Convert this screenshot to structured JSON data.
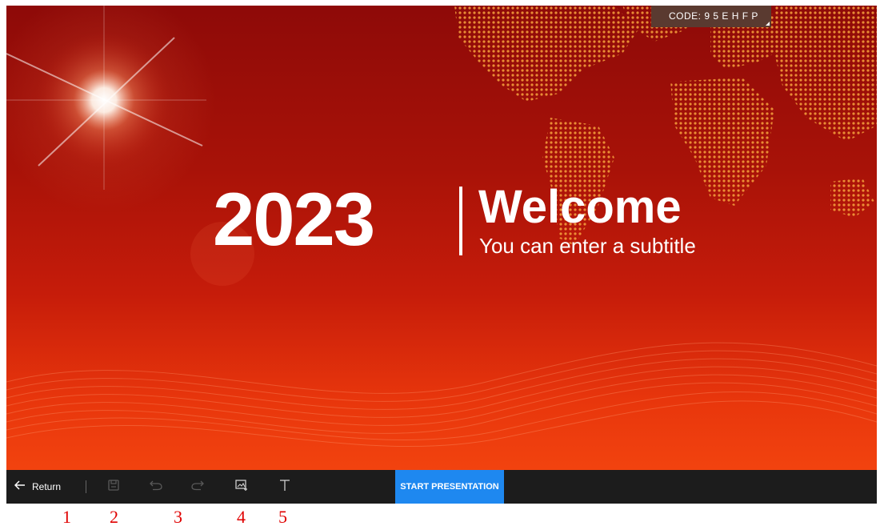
{
  "slide": {
    "year": "2023",
    "title": "Welcome",
    "subtitle": "You can enter a subtitle",
    "background_color": "#b5160a"
  },
  "room_code": {
    "text": "CODE: 9 5 E H F P"
  },
  "toolbar": {
    "return_label": "Return",
    "start_label": "START PRESENTATION",
    "start_color": "#1e88f0",
    "icons": {
      "return": "arrow-left-icon",
      "save": "save-icon",
      "undo": "undo-icon",
      "redo": "redo-icon",
      "image": "insert-image-icon",
      "text": "text-icon"
    }
  },
  "callouts": [
    "1",
    "2",
    "3",
    "4",
    "5"
  ]
}
